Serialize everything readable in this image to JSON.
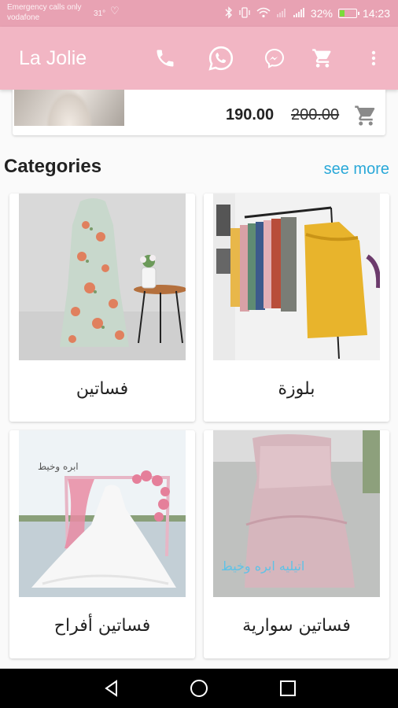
{
  "status_bar": {
    "carrier_line1": "Emergency calls only",
    "carrier_line2": "vodafone",
    "temperature": "31°",
    "battery_percent": "32%",
    "time": "14:23",
    "battery_level": 0.32,
    "battery_color": "#7bdc3a"
  },
  "app_bar": {
    "title": "La Jolie",
    "actions": [
      "phone-icon",
      "whatsapp-icon",
      "messenger-icon",
      "cart-icon",
      "more-vert-icon"
    ]
  },
  "product": {
    "price": "190.00",
    "old_price": "200.00"
  },
  "categories": {
    "title": "Categories",
    "see_more": "see more",
    "items": [
      {
        "label": "فساتين"
      },
      {
        "label": "بلوزة"
      },
      {
        "label": "فساتين أفراح"
      },
      {
        "label": "فساتين سوارية"
      }
    ]
  },
  "colors": {
    "status_bar": "#e8a2b3",
    "app_bar": "#f2b6c4",
    "link": "#29a8d8"
  }
}
